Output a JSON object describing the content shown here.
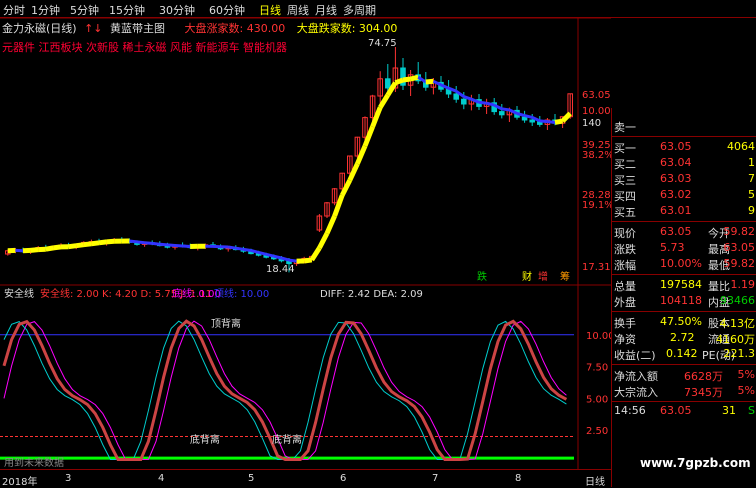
{
  "top_tabs": [
    "分时",
    "1分钟",
    "5分钟",
    "15分钟",
    "30分钟",
    "60分钟",
    "日线",
    "周线",
    "月线",
    "多周期"
  ],
  "active_tab": "日线",
  "title": {
    "name": "金力永磁(日线)",
    "arrows": "↑↓",
    "indicator": "黄蓝带主图",
    "big_up": "大盘涨家数: 430.00",
    "big_down": "大盘跌家数: 304.00"
  },
  "concepts": "元器件 江西板块 次新股 稀土永磁 风能 新能源车 智能机器",
  "main_price_labels": [
    {
      "text": "63.05",
      "y": 63.05,
      "color": "#f33"
    },
    {
      "text": "10.00%",
      "y": 59.0,
      "color": "#f33"
    },
    {
      "text": "140",
      "y": 56.0,
      "color": "#ddd"
    },
    {
      "text": "39.25",
      "y": 50.5,
      "color": "#f33"
    },
    {
      "text": "38.2%",
      "y": 48.0,
      "color": "#f33"
    },
    {
      "text": "28.28",
      "y": 38.0,
      "color": "#f33"
    },
    {
      "text": "19.1%",
      "y": 35.5,
      "color": "#f33"
    },
    {
      "text": "17.31",
      "y": 20.0,
      "color": "#f33"
    }
  ],
  "price_annotations": {
    "high": "74.75",
    "low": "18.44"
  },
  "chart_signal_labels": {
    "fall": "跌",
    "cai": "财",
    "zeng": "增",
    "chou": "筹"
  },
  "sub_header": {
    "name": "安全线",
    "vals": "安全线: 2.00  K: 4.20  D: 5.75  J: 1.11",
    "di": "底线: 0.00",
    "ding": "顶线: 10.00",
    "diff": "DIFF: 2.42  DEA: 2.09"
  },
  "sub_labels": {
    "ding_bei_li": "顶背离",
    "di_bei_li_1": "底背离",
    "di_bei_li_2": "底背离",
    "zhu_sheng": "主升",
    "data_note": "用到未来数据"
  },
  "sub_axis": [
    "10.00",
    "7.50",
    "5.00",
    "2.50"
  ],
  "date_axis": {
    "year": "2018年",
    "months": [
      "3",
      "4",
      "5",
      "6",
      "7",
      "8"
    ]
  },
  "bottom_tab": "日线",
  "order_book": {
    "sell1": {
      "label": "卖一",
      "price": "",
      "vol": ""
    },
    "buy1": {
      "label": "买一",
      "price": "63.05",
      "vol": "4064"
    },
    "buy2": {
      "label": "买二",
      "price": "63.04",
      "vol": "1"
    },
    "buy3": {
      "label": "买三",
      "price": "63.03",
      "vol": "7"
    },
    "buy4": {
      "label": "买四",
      "price": "63.02",
      "vol": "5"
    },
    "buy5": {
      "label": "买五",
      "price": "63.01",
      "vol": "9"
    }
  },
  "quote": {
    "now_l": "现价",
    "now": "63.05",
    "open_l": "今开",
    "open": "59.82",
    "chg_l": "涨跌",
    "chg": "5.73",
    "high_l": "最高",
    "high": "63.05",
    "pct_l": "涨幅",
    "pct": "10.00%",
    "low_l": "最低",
    "low": "59.82",
    "tot_l": "总量",
    "tot": "197584",
    "vr_l": "量比",
    "vr": "1.19",
    "out_l": "外盘",
    "out": "104118",
    "in_l": "内盘",
    "in": "93466",
    "turn_l": "换手",
    "turn": "47.50%",
    "cap_l": "股本",
    "cap": "4.13亿",
    "nav_l": "净资",
    "nav": "2.72",
    "flt_l": "流通",
    "flt": "4160万",
    "eps_l": "收益(二)",
    "eps": "0.142",
    "pe_l": "PE(动)",
    "pe": "221.3",
    "nf_l": "净流入额",
    "nf": "6628万",
    "nf_p": "5%",
    "big_l": "大宗流入",
    "big": "7345万",
    "big_p": "5%"
  },
  "tick": {
    "time": "14:56",
    "price": "63.05",
    "vol": "31",
    "flag": "S"
  },
  "watermark": "www.7gpzb.com",
  "chart_data": {
    "type": "candlestick",
    "title": "金力永磁(日线)",
    "ylim": [
      16,
      78
    ],
    "candles": [
      [
        23.0,
        24.1,
        22.6,
        23.8
      ],
      [
        23.8,
        24.5,
        23.2,
        24.0
      ],
      [
        24.0,
        24.6,
        23.3,
        23.6
      ],
      [
        23.6,
        24.3,
        23.0,
        24.2
      ],
      [
        24.2,
        25.0,
        23.8,
        24.6
      ],
      [
        24.6,
        25.3,
        24.1,
        24.4
      ],
      [
        24.4,
        25.1,
        23.9,
        24.9
      ],
      [
        24.9,
        25.7,
        24.3,
        25.2
      ],
      [
        25.2,
        25.8,
        24.6,
        24.8
      ],
      [
        24.8,
        25.6,
        24.2,
        25.4
      ],
      [
        25.4,
        26.2,
        25.0,
        25.9
      ],
      [
        25.9,
        26.6,
        25.3,
        26.1
      ],
      [
        26.1,
        26.8,
        25.5,
        25.8
      ],
      [
        25.8,
        26.5,
        25.1,
        26.3
      ],
      [
        26.3,
        27.0,
        25.8,
        26.6
      ],
      [
        26.6,
        27.2,
        26.0,
        26.2
      ],
      [
        26.2,
        26.9,
        25.6,
        25.9
      ],
      [
        25.9,
        26.4,
        25.1,
        25.4
      ],
      [
        25.4,
        26.1,
        24.8,
        25.8
      ],
      [
        25.8,
        26.4,
        25.2,
        25.5
      ],
      [
        25.5,
        26.2,
        24.9,
        25.1
      ],
      [
        25.1,
        25.8,
        24.4,
        24.7
      ],
      [
        24.7,
        25.5,
        24.1,
        25.2
      ],
      [
        25.2,
        25.9,
        24.6,
        25.0
      ],
      [
        25.0,
        25.6,
        24.3,
        24.6
      ],
      [
        24.6,
        25.3,
        23.9,
        24.9
      ],
      [
        24.9,
        25.6,
        24.3,
        25.3
      ],
      [
        25.3,
        26.0,
        24.7,
        24.8
      ],
      [
        24.8,
        25.4,
        24.0,
        24.3
      ],
      [
        24.3,
        25.0,
        23.6,
        24.6
      ],
      [
        24.6,
        25.2,
        23.9,
        24.1
      ],
      [
        24.1,
        24.8,
        23.3,
        23.7
      ],
      [
        23.7,
        24.3,
        22.9,
        23.1
      ],
      [
        23.1,
        23.8,
        22.4,
        22.7
      ],
      [
        22.7,
        23.3,
        21.9,
        22.2
      ],
      [
        22.2,
        22.9,
        21.5,
        21.8
      ],
      [
        21.8,
        22.5,
        20.9,
        21.3
      ],
      [
        21.3,
        22.0,
        18.4,
        20.6
      ],
      [
        20.6,
        21.5,
        20.0,
        21.2
      ],
      [
        21.2,
        22.3,
        20.7,
        21.9
      ],
      [
        21.9,
        22.6,
        21.3,
        22.4
      ],
      [
        29.0,
        33.0,
        28.5,
        32.5
      ],
      [
        32.5,
        36.0,
        32.0,
        35.8
      ],
      [
        35.8,
        39.5,
        35.2,
        39.3
      ],
      [
        39.3,
        43.3,
        38.8,
        43.2
      ],
      [
        43.2,
        47.6,
        42.6,
        47.5
      ],
      [
        47.5,
        52.3,
        47.0,
        52.2
      ],
      [
        52.2,
        57.4,
        51.0,
        57.1
      ],
      [
        57.1,
        62.8,
        56.0,
        62.5
      ],
      [
        62.5,
        68.7,
        60.5,
        66.8
      ],
      [
        66.8,
        70.5,
        63.0,
        64.5
      ],
      [
        64.5,
        74.75,
        63.5,
        69.5
      ],
      [
        69.5,
        72.0,
        64.0,
        65.2
      ],
      [
        65.2,
        69.0,
        62.5,
        67.8
      ],
      [
        67.8,
        71.0,
        65.5,
        66.3
      ],
      [
        66.3,
        68.5,
        63.8,
        64.7
      ],
      [
        64.7,
        67.0,
        62.9,
        65.9
      ],
      [
        65.9,
        67.5,
        63.5,
        64.2
      ],
      [
        64.2,
        66.5,
        62.0,
        63.0
      ],
      [
        63.0,
        65.0,
        60.8,
        61.7
      ],
      [
        61.7,
        63.5,
        59.2,
        60.5
      ],
      [
        60.5,
        62.8,
        58.9,
        61.6
      ],
      [
        61.6,
        63.0,
        59.0,
        59.9
      ],
      [
        59.9,
        61.8,
        58.0,
        60.8
      ],
      [
        60.8,
        62.0,
        57.8,
        58.6
      ],
      [
        58.6,
        60.5,
        56.9,
        57.8
      ],
      [
        57.8,
        59.6,
        56.0,
        58.9
      ],
      [
        58.9,
        60.0,
        56.6,
        57.2
      ],
      [
        57.2,
        58.8,
        55.8,
        56.5
      ],
      [
        56.5,
        58.0,
        55.0,
        56.0
      ],
      [
        56.0,
        57.5,
        54.8,
        55.4
      ],
      [
        55.4,
        57.0,
        54.0,
        56.5
      ],
      [
        56.5,
        58.0,
        55.2,
        55.7
      ],
      [
        55.7,
        57.3,
        54.5,
        57.32
      ],
      [
        57.32,
        63.05,
        56.8,
        63.05
      ]
    ]
  }
}
